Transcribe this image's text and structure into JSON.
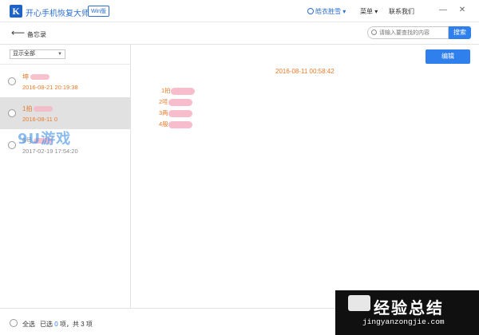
{
  "app": {
    "logo_letter": "K",
    "title": "开心手机恢复大师",
    "badge": "Win版",
    "user": "皓衣胜雪 ▾",
    "menu": "菜单 ▾",
    "contact": "联系我们",
    "window_controls": [
      "—",
      "✕"
    ]
  },
  "toolbar": {
    "title": "备忘录",
    "search_placeholder": "请输入要查找的内容",
    "search_button": "搜索"
  },
  "filter": {
    "selected": "显示全部"
  },
  "notes": [
    {
      "title": "坤",
      "date": "2016-08-21 20:19:38",
      "selected": false
    },
    {
      "title": "1拍",
      "date": "2016-08-11 0",
      "selected": true
    },
    {
      "title": "6号",
      "date": "2017-02-19 17:54:20",
      "selected": false
    }
  ],
  "watermark": "9U游戏",
  "detail": {
    "edit_button": "编辑",
    "date": "2016-08-11 00:58:42",
    "lines": [
      "1拍",
      "2哇",
      "3两",
      "4般"
    ]
  },
  "footer": {
    "select_all": "全选",
    "selected_prefix": "已选",
    "selected_count": "0",
    "selected_suffix": "项，共 3 项"
  },
  "corner_watermark": {
    "cn": "经验总结",
    "en": "jingyanzongjie.com"
  },
  "colors": {
    "accent": "#2f80ed",
    "note_text": "#e87b2b"
  }
}
